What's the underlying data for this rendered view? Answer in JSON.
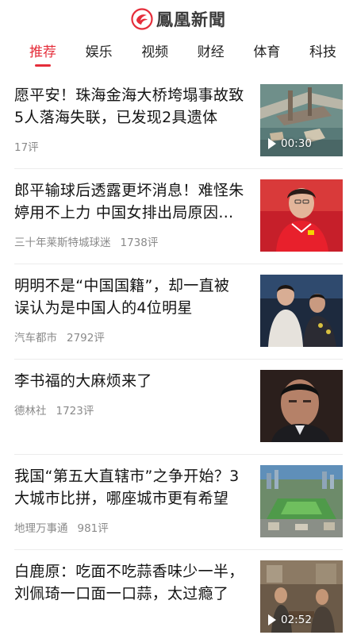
{
  "app": {
    "logo_text": "鳳凰新聞",
    "accent_color": "#e52d3a"
  },
  "tabs": [
    {
      "label": "推荐",
      "active": true
    },
    {
      "label": "娱乐"
    },
    {
      "label": "视频"
    },
    {
      "label": "财经"
    },
    {
      "label": "体育"
    },
    {
      "label": "科技"
    }
  ],
  "feed": [
    {
      "title": "愿平安！珠海金海大桥垮塌事故致5人落海失联，已发现2具遗体",
      "source": "",
      "comments": "17评",
      "video_duration": "00:30",
      "thumb": "bridge-collapse-aerial"
    },
    {
      "title": "郎平输球后透露更坏消息！难怪朱婷用不上力 中国女排出局原因找到",
      "source": "三十年莱斯特城球迷",
      "comments": "1738评",
      "thumb": "coach-red-jersey"
    },
    {
      "title": "明明不是“中国国籍”，却一直被误认为是中国人的4位明星",
      "source": "汽车都市",
      "comments": "2792评",
      "thumb": "two-celebrities-stage"
    },
    {
      "title": "李书福的大麻烦来了",
      "source": "德林社",
      "comments": "1723评",
      "thumb": "businessman-portrait"
    },
    {
      "title": "我国“第五大直辖市”之争开始？3大城市比拼，哪座城市更有希望",
      "source": "地理万事通",
      "comments": "981评",
      "thumb": "city-aerial-view"
    },
    {
      "title": "白鹿原：吃面不吃蒜香味少一半，刘佩琦一口面一口蒜，太过瘾了",
      "source": "",
      "comments": "",
      "video_duration": "02:52",
      "thumb": "tv-drama-scene"
    }
  ]
}
